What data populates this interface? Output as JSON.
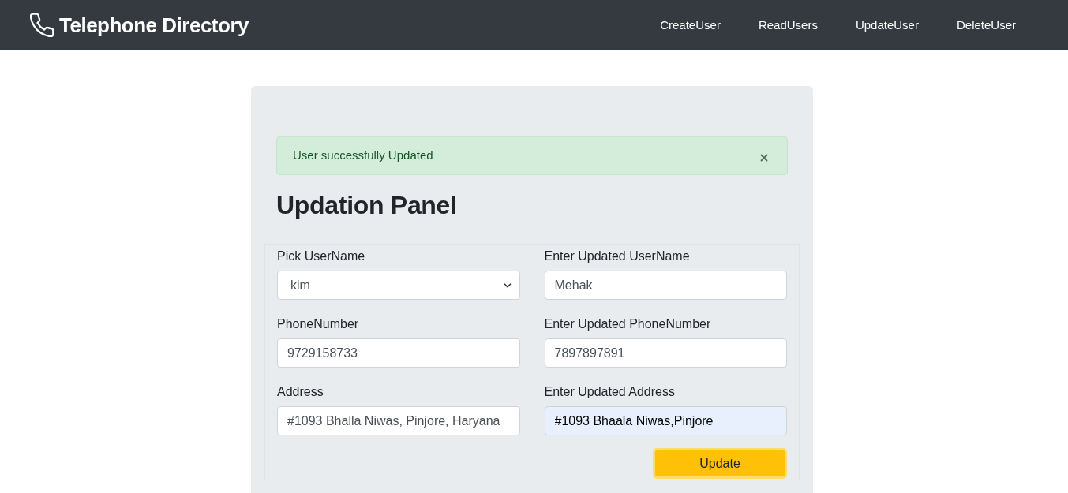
{
  "navbar": {
    "brand": "Telephone Directory",
    "links": [
      {
        "label": "CreateUser"
      },
      {
        "label": "ReadUsers"
      },
      {
        "label": "UpdateUser"
      },
      {
        "label": "DeleteUser"
      }
    ]
  },
  "alert": {
    "message": "User successfully Updated",
    "dismissible": true
  },
  "panel": {
    "title": "Updation Panel",
    "fields": [
      {
        "kind": "select",
        "label": "Pick UserName",
        "value": "kim",
        "autofilled": false
      },
      {
        "kind": "input",
        "label": "Enter Updated UserName",
        "value": "Mehak",
        "autofilled": false
      },
      {
        "kind": "input",
        "label": "PhoneNumber",
        "value": "9729158733",
        "autofilled": false
      },
      {
        "kind": "input",
        "label": "Enter Updated PhoneNumber",
        "value": "7897897891",
        "autofilled": false
      },
      {
        "kind": "input",
        "label": "Address",
        "value": "#1093 Bhalla Niwas, Pinjore, Haryana",
        "autofilled": false
      },
      {
        "kind": "input",
        "label": "Enter Updated Address",
        "value": "#1093 Bhaala Niwas,Pinjore",
        "autofilled": true
      }
    ],
    "submit": {
      "label": "Update",
      "focused": true
    }
  }
}
